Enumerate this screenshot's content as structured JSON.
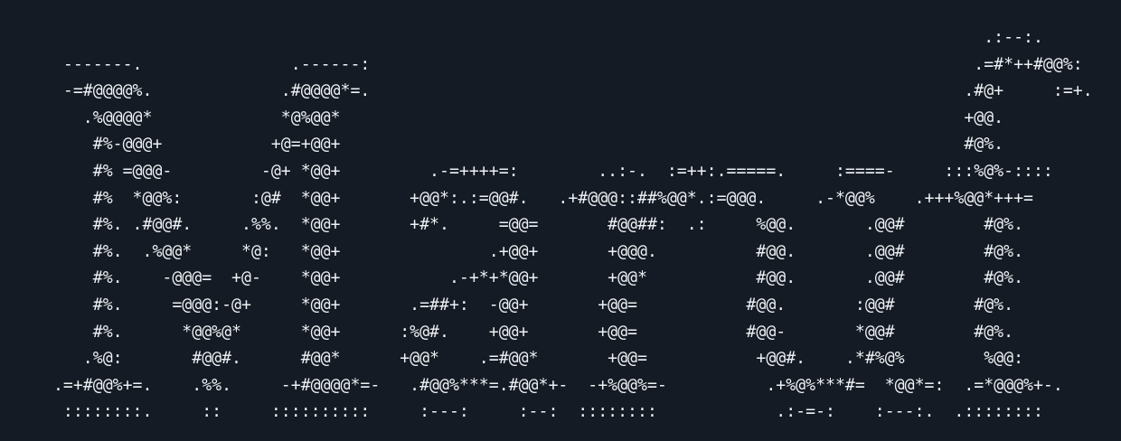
{
  "ascii_art": {
    "lines": [
      "                                                                                               .:--:.",
      "  -------.               .------:                                                             .=#*++#@@%:",
      "  -=#@@@@%.             .#@@@@*=.                                                            .#@+     :=+.",
      "    .%@@@@*             *@%@@*                                                               +@@.",
      "     #%-@@@+           +@=+@@+                                                               #@%.",
      "     #% =@@@-         -@+ *@@+         .-=++++=:        ..:-.  :=++:.=====.     :====-     :::%@%-::::",
      "     #%  *@@%:       :@#  *@@+       +@@*:.:=@@#.   .+#@@@::##%@@*.:=@@@.     .-*@@%    .+++%@@*+++=",
      "     #%. .#@@#.     .%%.  *@@+       +#*.     =@@=       #@@##:  .:     %@@.       .@@#        #@%.",
      "     #%.  .%@@*     *@:   *@@+               .+@@+       +@@@.          #@@.       .@@#        #@%.",
      "     #%.    -@@@=  +@-    *@@+           .-+*+*@@+       +@@*           #@@.       .@@#        #@%.",
      "     #%.     =@@@:-@+     *@@+       .=##+:  -@@+       +@@=           #@@.       :@@#        #@%.",
      "     #%.      *@@%@*      *@@+      :%@#.    +@@+       +@@=           #@@-       *@@#        #@%.",
      "    .%@:       #@@#.      #@@*      +@@*    .=#@@*       +@@=           +@@#.    .*#%@%        %@@:",
      " .=+#@@%+=.    .%%.     -+#@@@@*=-   .#@@%***=.#@@*+-  -+%@@%=-          .+%@%***#=  *@@*=:  .=*@@@%+-.",
      "  ::::::::.     ::     ::::::::::     :---:     :--:  ::::::::            .:-=-:    :---:.  .::::::::"
    ]
  }
}
